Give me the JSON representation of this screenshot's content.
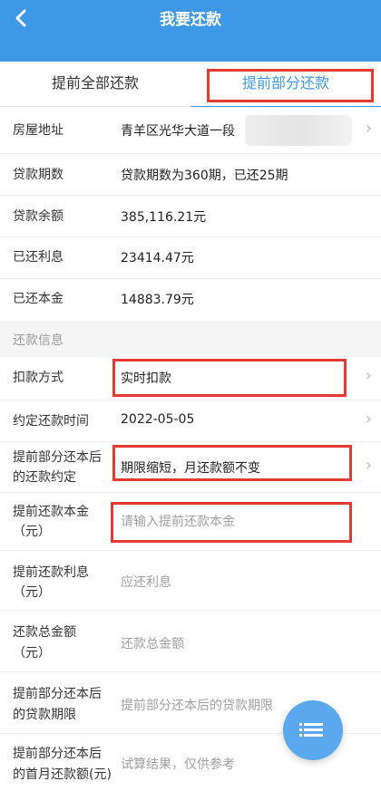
{
  "header": {
    "title": "我要还款",
    "back_icon": "‹"
  },
  "tabs": [
    {
      "label": "提前全部还款",
      "active": false
    },
    {
      "label": "提前部分还款",
      "active": true
    }
  ],
  "loan_info": {
    "address_label": "房屋地址",
    "address_value": "青羊区光华大道一段",
    "term_label": "贷款期数",
    "term_value": "贷款期数为360期，已还25期",
    "balance_label": "贷款余额",
    "balance_value": "385,116.21元",
    "interest_paid_label": "已还利息",
    "interest_paid_value": "23414.47元",
    "principal_paid_label": "已还本金",
    "principal_paid_value": "14883.79元"
  },
  "section_title": "还款信息",
  "repay_info": {
    "method_label": "扣款方式",
    "method_value": "实时扣款",
    "date_label": "约定还款时间",
    "date_value": "2022-05-05",
    "agreement_label_1": "提前部分还本后",
    "agreement_label_2": "的还款约定",
    "agreement_value": "期限缩短，月还款额不变",
    "principal_label_1": "提前还款本金",
    "principal_label_2": "（元）",
    "principal_placeholder": "请输入提前还款本金",
    "interest_label_1": "提前还款利息",
    "interest_label_2": "（元）",
    "interest_placeholder": "应还利息",
    "total_label_1": "还款总金额",
    "total_label_2": "（元）",
    "total_placeholder": "还款总金额",
    "term_after_label_1": "提前部分还本后",
    "term_after_label_2": "的贷款期限",
    "term_after_placeholder": "提前部分还本后的贷款期限",
    "first_month_label_1": "提前部分还本后",
    "first_month_label_2": "的首月还款额(元)",
    "first_month_placeholder": "试算结果，仅供参考"
  },
  "colors": {
    "header_bg": "#3d98e8",
    "accent": "#3d98e8",
    "highlight_red": "#e23b33",
    "fab_bg": "#5ba8ee"
  },
  "icons": {
    "chevron": "›",
    "fab_icon": "list-icon"
  }
}
